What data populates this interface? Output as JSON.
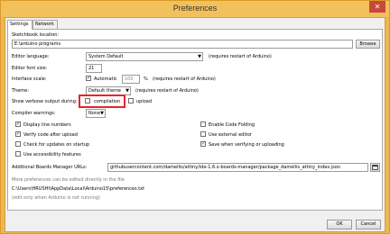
{
  "window": {
    "title": "Preferences",
    "close_glyph": "✕"
  },
  "tabs": [
    {
      "label": "Settings"
    },
    {
      "label": "Network"
    }
  ],
  "sketchbook": {
    "label": "Sketchbook location:",
    "value": "E:\\arduino programs",
    "browse": "Browse"
  },
  "editor_language": {
    "label": "Editor language:",
    "value": "System Default",
    "note": "(requires restart of Arduino)"
  },
  "font_size": {
    "label": "Editor font size:",
    "value": "21"
  },
  "interface_scale": {
    "label": "Interface scale:",
    "automatic": "Automatic",
    "percent": "100",
    "percent_sign": "%",
    "note": "(requires restart of Arduino)"
  },
  "theme": {
    "label": "Theme:",
    "value": "Default theme",
    "note": "(requires restart of Arduino)"
  },
  "verbose": {
    "label": "Show verbose output during:",
    "compilation": "compilation",
    "upload": "upload"
  },
  "warnings": {
    "label": "Compiler warnings:",
    "value": "None"
  },
  "options_left": [
    {
      "label": "Display line numbers",
      "checked": true
    },
    {
      "label": "Verify code after upload",
      "checked": true
    },
    {
      "label": "Check for updates on startup",
      "checked": false
    },
    {
      "label": "Use accessibility features",
      "checked": false
    }
  ],
  "options_right": [
    {
      "label": "Enable Code Folding",
      "checked": false
    },
    {
      "label": "Use external editor",
      "checked": false
    },
    {
      "label": "Save when verifying or uploading",
      "checked": true
    }
  ],
  "boards": {
    "label": "Additional Boards Manager URLs:",
    "value": "githubusercontent.com/damellis/attiny/ide-1.6.x-boards-manager/package_damellis_attiny_index.json"
  },
  "more_prefs": "More preferences can be edited directly in the file",
  "prefs_path": "C:\\Users\\HRUSHI\\AppData\\Local\\Arduino15\\preferences.txt",
  "edit_note": "(edit only when Arduino is not running)",
  "footer": {
    "ok": "OK",
    "cancel": "Cancel"
  },
  "check_glyph": "✓"
}
